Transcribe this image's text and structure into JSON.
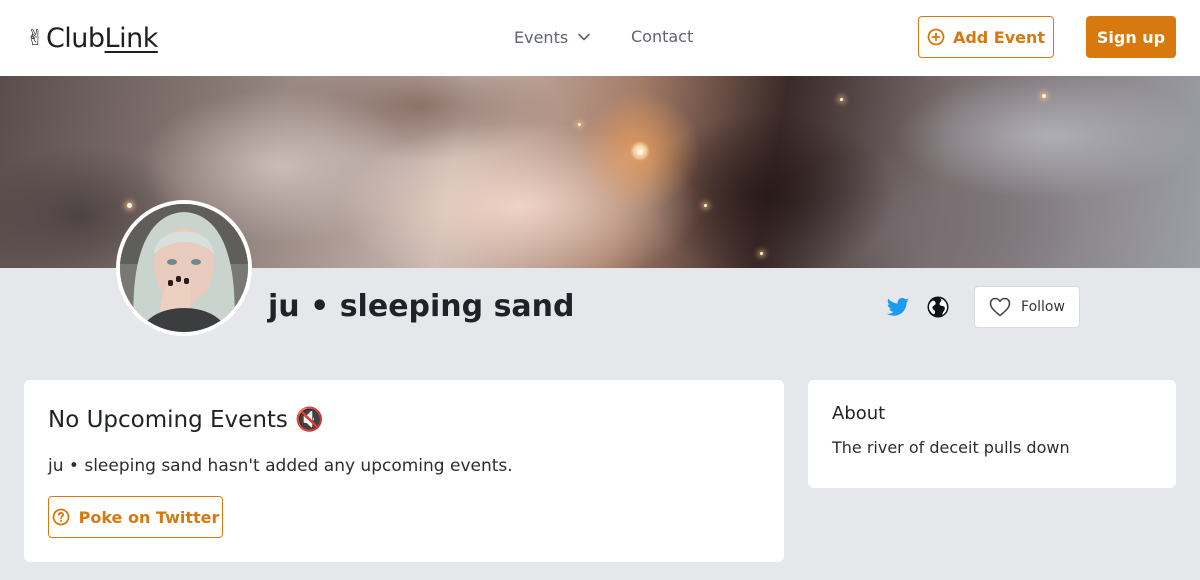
{
  "brand": {
    "logo_icon": "victory-hand-emoji",
    "logo_hand": "✌",
    "logo_club": "Club",
    "logo_link": "Link",
    "accent_color": "#d7790f"
  },
  "nav": {
    "events_label": "Events",
    "contact_label": "Contact"
  },
  "header_actions": {
    "add_event_label": "Add Event",
    "signup_label": "Sign up"
  },
  "profile": {
    "name": "ju • sleeping sand",
    "follow_label": "Follow",
    "social_icons": [
      "twitter-icon",
      "globe-icon"
    ]
  },
  "events_card": {
    "title": "No Upcoming Events",
    "title_emoji": "🔇",
    "description": "ju • sleeping sand hasn't added any upcoming events.",
    "poke_label": "Poke on Twitter"
  },
  "about_card": {
    "title": "About",
    "text": "The river of deceit pulls down"
  }
}
